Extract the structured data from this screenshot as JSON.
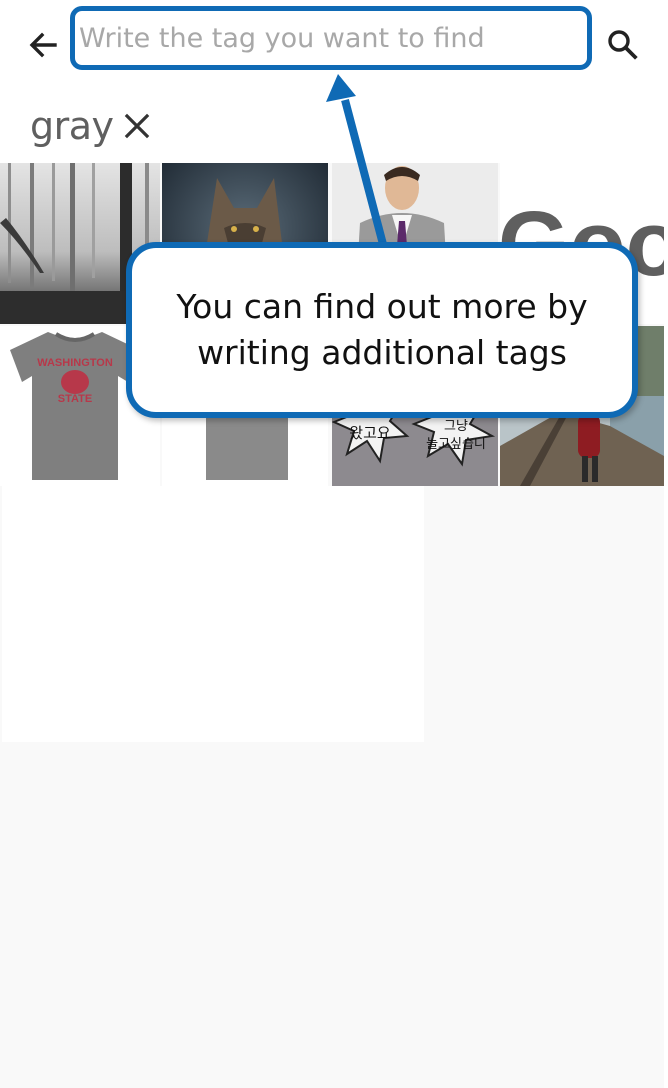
{
  "header": {
    "back_icon": "arrow-left-icon",
    "search_placeholder": "Write the tag you want to find",
    "search_value": "",
    "search_icon": "magnifier-icon"
  },
  "tags": [
    {
      "label": "gray",
      "remove_icon": "close-icon"
    }
  ],
  "grid": {
    "items": [
      {
        "subject": "foggy forest"
      },
      {
        "subject": "wolf"
      },
      {
        "subject": "man in gray suit"
      },
      {
        "subject": "Google logo",
        "text": "Google"
      },
      {
        "subject": "Washington State t-shirt",
        "text_line1": "WASHINGTON",
        "text_line2": "STATE"
      },
      {
        "subject": "gray t-shirt"
      },
      {
        "subject": "Korean comic",
        "text_a": "왔고요",
        "text_b": "그냥\n놀고싶습니다"
      },
      {
        "subject": "person on boardwalk"
      }
    ]
  },
  "callout": {
    "text": "You can find out more by writing additional tags",
    "color": "#0f6ab5"
  }
}
